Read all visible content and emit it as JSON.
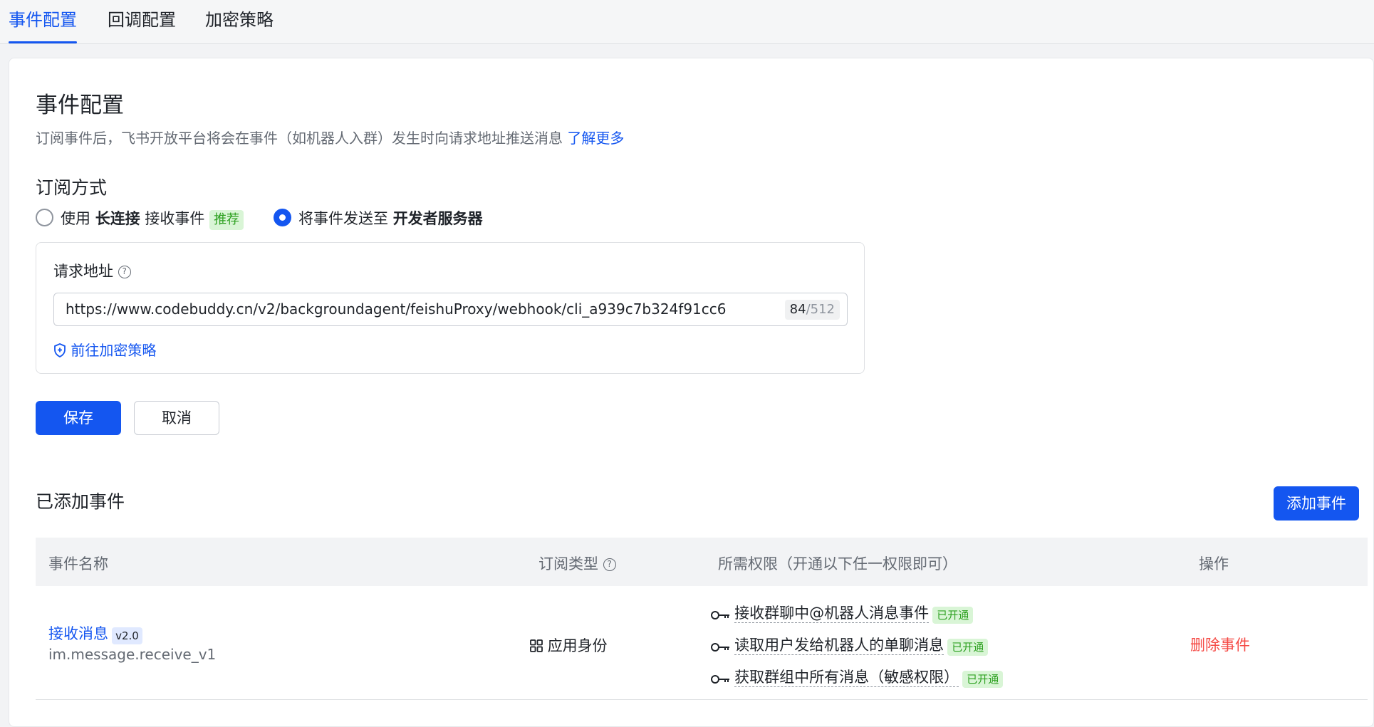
{
  "tabs": [
    {
      "label": "事件配置",
      "active": true
    },
    {
      "label": "回调配置",
      "active": false
    },
    {
      "label": "加密策略",
      "active": false
    }
  ],
  "section": {
    "title": "事件配置",
    "description": "订阅事件后，飞书开放平台将会在事件（如机器人入群）发生时向请求地址推送消息",
    "learn_more": "了解更多"
  },
  "subscription": {
    "title": "订阅方式",
    "option1": {
      "prefix": "使用",
      "bold": "长连接",
      "suffix": "接收事件",
      "tag": "推荐",
      "selected": false
    },
    "option2": {
      "prefix": "将事件发送至",
      "bold": "开发者服务器",
      "selected": true
    }
  },
  "request_url": {
    "label": "请求地址",
    "help": "?",
    "value": "https://www.codebuddy.cn/v2/backgroundagent/feishuProxy/webhook/cli_a939c7b324f91cc6",
    "counter_current": "84",
    "counter_max": "/512",
    "encrypt_link": "前往加密策略"
  },
  "buttons": {
    "save": "保存",
    "cancel": "取消",
    "add_event": "添加事件"
  },
  "added_events": {
    "title": "已添加事件",
    "columns": {
      "name": "事件名称",
      "type": "订阅类型",
      "permissions": "所需权限（开通以下任一权限即可）",
      "actions": "操作"
    },
    "rows": [
      {
        "name": "接收消息",
        "version": "v2.0",
        "event_key": "im.message.receive_v1",
        "type": "应用身份",
        "permissions": [
          {
            "label": "接收群聊中@机器人消息事件",
            "status": "已开通"
          },
          {
            "label": "读取用户发给机器人的单聊消息",
            "status": "已开通"
          },
          {
            "label": "获取群组中所有消息（敏感权限）",
            "status": "已开通"
          }
        ],
        "action": "删除事件"
      }
    ]
  },
  "colors": {
    "primary": "#1456f0",
    "success": "#2ea121",
    "danger": "#f54a45",
    "muted": "#646a73"
  }
}
